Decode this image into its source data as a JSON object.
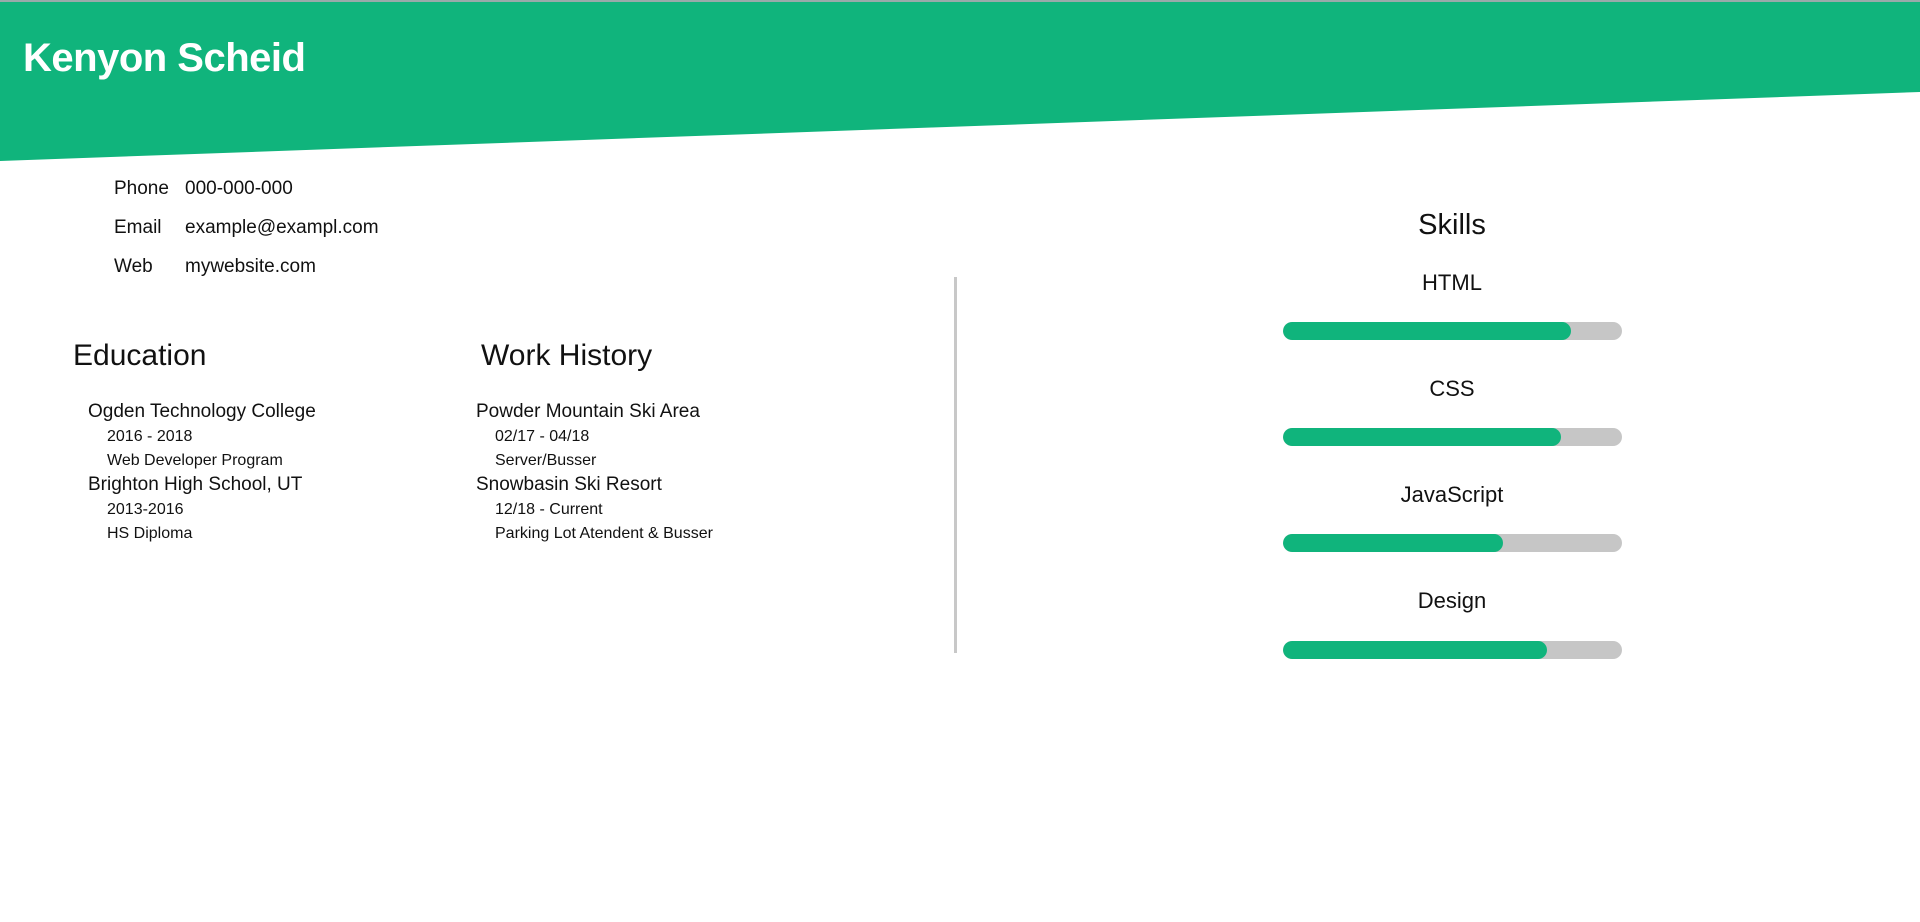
{
  "header": {
    "name": "Kenyon Scheid",
    "accent_color": "#10b47c"
  },
  "contact": [
    {
      "label": "Phone",
      "value": "000-000-000"
    },
    {
      "label": "Email",
      "value": "example@exampl.com"
    },
    {
      "label": "Web",
      "value": "mywebsite.com"
    }
  ],
  "education": {
    "title": "Education",
    "items": [
      {
        "name": "Ogden Technology College",
        "dates": "2016 - 2018",
        "detail": "Web Developer Program"
      },
      {
        "name": "Brighton High School, UT",
        "dates": "2013-2016",
        "detail": "HS Diploma"
      }
    ]
  },
  "work": {
    "title": "Work History",
    "items": [
      {
        "name": "Powder Mountain Ski Area",
        "dates": "02/17 - 04/18",
        "detail": "Server/Busser"
      },
      {
        "name": "Snowbasin Ski Resort",
        "dates": "12/18 - Current",
        "detail": "Parking Lot Atendent & Busser"
      }
    ]
  },
  "skills": {
    "title": "Skills",
    "track_color": "#c6c6c6",
    "items": [
      {
        "label": "HTML",
        "level": 0.85
      },
      {
        "label": "CSS",
        "level": 0.82
      },
      {
        "label": "JavaScript",
        "level": 0.65
      },
      {
        "label": "Design",
        "level": 0.78
      }
    ]
  }
}
